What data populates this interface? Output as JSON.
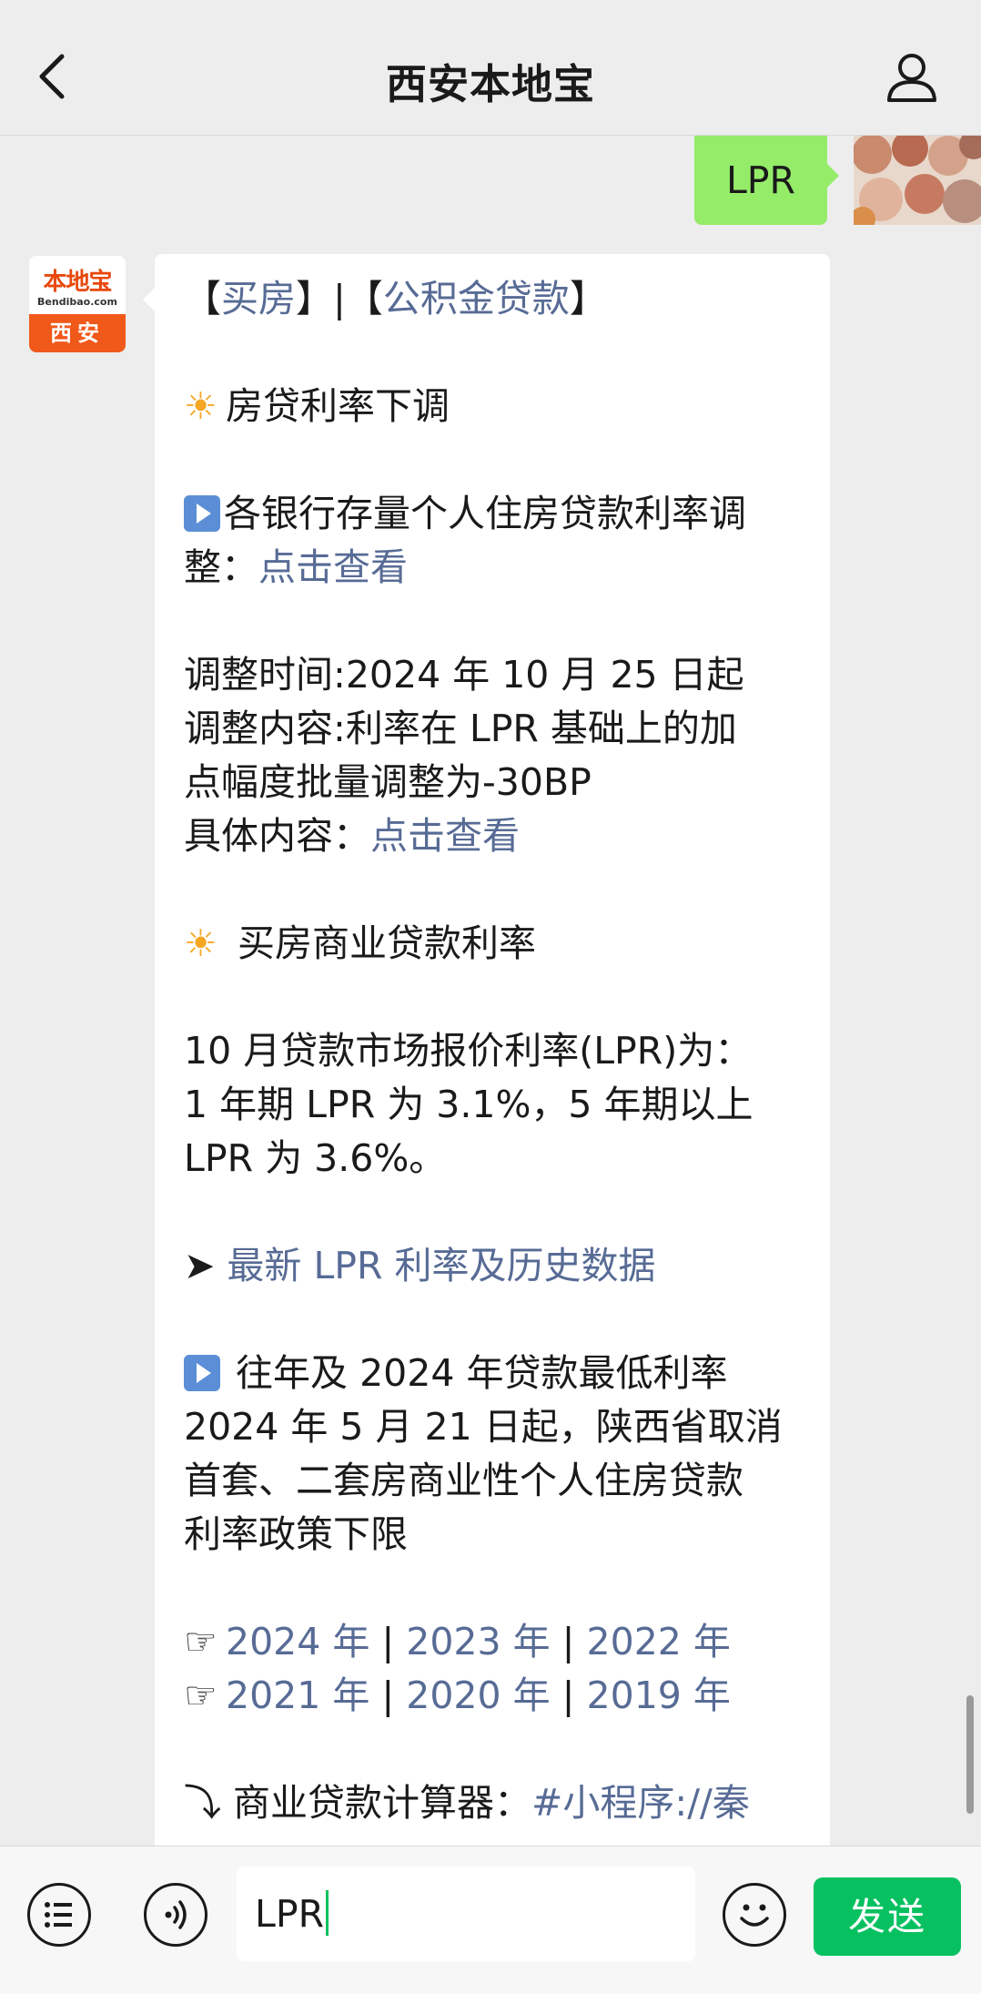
{
  "header": {
    "title": "西安本地宝"
  },
  "my_message": {
    "text": "LPR"
  },
  "bot_avatar": {
    "logo_text": "本地宝",
    "domain": "Bendibao.com",
    "city": "西安"
  },
  "bot_message": {
    "l1_a": "【",
    "l1_link1": "买房",
    "l1_b": "】|【",
    "l1_link2": "公积金贷款",
    "l1_c": "】",
    "s1_icon": "☀",
    "s1_title": "房贷利率下调",
    "p1_a": "各银行存量个人住房贷款利率调",
    "p1_b": "整：",
    "p1_link": "点击查看",
    "p2_l1": "调整时间:2024 年 10 月 25 日起",
    "p2_l2": "调整内容:利率在 LPR 基础上的加",
    "p2_l3": "点幅度批量调整为-30BP",
    "p2_l4a": "具体内容：",
    "p2_link": "点击查看",
    "s2_icon": "☀",
    "s2_title": " 买房商业贷款利率",
    "p3_l1": "10 月贷款市场报价利率(LPR)为：",
    "p3_l2": "1 年期 LPR 为 3.1%，5 年期以上",
    "p3_l3": "LPR 为 3.6%。",
    "arrow": "➤",
    "p4_link": "最新 LPR 利率及历史数据",
    "p5_title": "往年及 2024 年贷款最低利率",
    "p5_l2": "2024 年 5 月 21 日起，陕西省取消",
    "p5_l3": "首套、二套房商业性个人住房贷款",
    "p5_l4": "利率政策下限",
    "hand": "☞",
    "years_row1": [
      "2024 年",
      "2023 年",
      "2022 年"
    ],
    "years_row2": [
      "2021 年",
      "2020 年",
      "2019 年"
    ],
    "sep": " | ",
    "calc_icon": "⤵",
    "calc_label": " 商业贷款计算器：",
    "calc_link": "#小程序://秦"
  },
  "input_bar": {
    "input_value": "LPR",
    "send_label": "发送"
  },
  "colors": {
    "link": "#576b95",
    "send": "#07c160",
    "my_bubble": "#95ec69",
    "avatar_orange": "#f0591a"
  },
  "icons": [
    "back-icon",
    "user-icon",
    "menu-icon",
    "voice-icon",
    "emoji-icon"
  ]
}
